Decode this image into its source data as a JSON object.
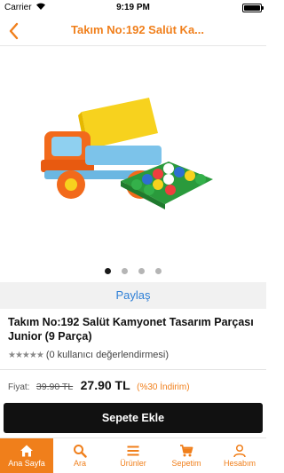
{
  "status_bar": {
    "carrier": "Carrier",
    "time": "9:19 PM"
  },
  "nav": {
    "title": "Takım No:192 Salüt  Ka..."
  },
  "gallery": {
    "page_count": 4,
    "active_index": 0
  },
  "share": {
    "label": "Paylaş"
  },
  "product": {
    "title": "Takım No:192 Salüt  Kamyonet Tasarım Parçası Junior (9 Parça)",
    "rating_text": "(0 kullanıcı değerlendirmesi)",
    "rating_value": 0
  },
  "price": {
    "label": "Fiyat:",
    "old": "39.90 TL",
    "new": "27.90 TL",
    "discount": "(%30 İndirim)"
  },
  "cart": {
    "label": "Sepete Ekle"
  },
  "tabs": [
    {
      "label": "Ana Sayfa",
      "icon": "home-icon"
    },
    {
      "label": "Ara",
      "icon": "search-icon"
    },
    {
      "label": "Ürünler",
      "icon": "menu-icon"
    },
    {
      "label": "Sepetim",
      "icon": "cart-icon"
    },
    {
      "label": "Hesabım",
      "icon": "user-icon"
    }
  ],
  "colors": {
    "accent": "#f07f1b",
    "link": "#2e7fd6",
    "button": "#111111"
  }
}
